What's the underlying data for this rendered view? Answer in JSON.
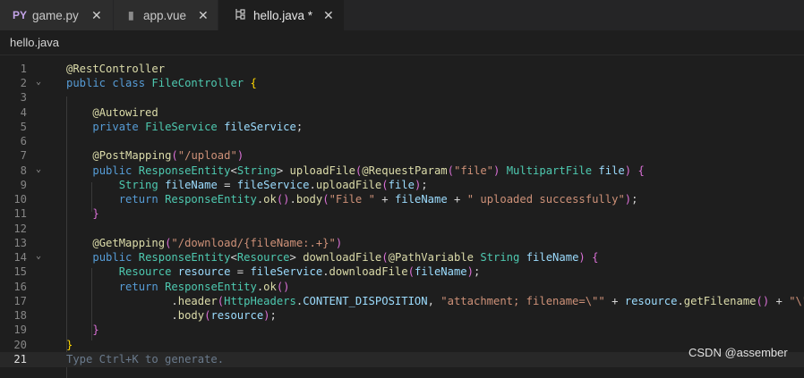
{
  "tabs": [
    {
      "icon": "PY",
      "icon_name": "python-file-icon",
      "label": "game.py",
      "active": false,
      "icon_color": "#c3a4e8"
    },
    {
      "icon": "▮",
      "icon_name": "file-icon",
      "label": "app.vue",
      "active": false,
      "icon_color": "#8a8a8a"
    },
    {
      "icon": "⊱",
      "icon_name": "java-file-icon",
      "label": "hello.java *",
      "active": true,
      "icon_color": "#c8c8c8"
    }
  ],
  "breadcrumb": "hello.java",
  "current_line": 21,
  "lines": [
    {
      "n": "1",
      "fold": false,
      "tokens": [
        {
          "t": "@RestController",
          "c": "ann"
        }
      ]
    },
    {
      "n": "2",
      "fold": true,
      "tokens": [
        {
          "t": "public class ",
          "c": "kw"
        },
        {
          "t": "FileController",
          "c": "cls"
        },
        {
          "t": " ",
          "c": "default"
        },
        {
          "t": "{",
          "c": "brace"
        }
      ]
    },
    {
      "n": "3",
      "fold": false,
      "tokens": []
    },
    {
      "n": "4",
      "fold": false,
      "tokens": [
        {
          "t": "    ",
          "c": "default"
        },
        {
          "t": "@Autowired",
          "c": "ann"
        }
      ]
    },
    {
      "n": "5",
      "fold": false,
      "tokens": [
        {
          "t": "    ",
          "c": "default"
        },
        {
          "t": "private ",
          "c": "kw"
        },
        {
          "t": "FileService ",
          "c": "type"
        },
        {
          "t": "fileService",
          "c": "var"
        },
        {
          "t": ";",
          "c": "punct"
        }
      ]
    },
    {
      "n": "6",
      "fold": false,
      "tokens": []
    },
    {
      "n": "7",
      "fold": false,
      "tokens": [
        {
          "t": "    ",
          "c": "default"
        },
        {
          "t": "@PostMapping",
          "c": "ann"
        },
        {
          "t": "(",
          "c": "brace2"
        },
        {
          "t": "\"/upload\"",
          "c": "str"
        },
        {
          "t": ")",
          "c": "brace2"
        }
      ]
    },
    {
      "n": "8",
      "fold": true,
      "tokens": [
        {
          "t": "    ",
          "c": "default"
        },
        {
          "t": "public ",
          "c": "kw"
        },
        {
          "t": "ResponseEntity",
          "c": "type"
        },
        {
          "t": "<",
          "c": "punct"
        },
        {
          "t": "String",
          "c": "type"
        },
        {
          "t": "> ",
          "c": "punct"
        },
        {
          "t": "uploadFile",
          "c": "fn"
        },
        {
          "t": "(",
          "c": "brace2"
        },
        {
          "t": "@RequestParam",
          "c": "ann"
        },
        {
          "t": "(",
          "c": "brace2"
        },
        {
          "t": "\"file\"",
          "c": "str"
        },
        {
          "t": ")",
          "c": "brace2"
        },
        {
          "t": " MultipartFile ",
          "c": "type"
        },
        {
          "t": "file",
          "c": "var"
        },
        {
          "t": ")",
          "c": "brace2"
        },
        {
          "t": " ",
          "c": "default"
        },
        {
          "t": "{",
          "c": "brace2"
        }
      ]
    },
    {
      "n": "9",
      "fold": false,
      "tokens": [
        {
          "t": "        ",
          "c": "default"
        },
        {
          "t": "String ",
          "c": "type"
        },
        {
          "t": "fileName",
          "c": "var"
        },
        {
          "t": " = ",
          "c": "punct"
        },
        {
          "t": "fileService",
          "c": "var"
        },
        {
          "t": ".",
          "c": "punct"
        },
        {
          "t": "uploadFile",
          "c": "fn"
        },
        {
          "t": "(",
          "c": "brace2"
        },
        {
          "t": "file",
          "c": "var"
        },
        {
          "t": ")",
          "c": "brace2"
        },
        {
          "t": ";",
          "c": "punct"
        }
      ]
    },
    {
      "n": "10",
      "fold": false,
      "tokens": [
        {
          "t": "        ",
          "c": "default"
        },
        {
          "t": "return ",
          "c": "kw"
        },
        {
          "t": "ResponseEntity",
          "c": "type"
        },
        {
          "t": ".",
          "c": "punct"
        },
        {
          "t": "ok",
          "c": "fn"
        },
        {
          "t": "()",
          "c": "brace2"
        },
        {
          "t": ".",
          "c": "punct"
        },
        {
          "t": "body",
          "c": "fn"
        },
        {
          "t": "(",
          "c": "brace2"
        },
        {
          "t": "\"File \"",
          "c": "str"
        },
        {
          "t": " + ",
          "c": "punct"
        },
        {
          "t": "fileName",
          "c": "var"
        },
        {
          "t": " + ",
          "c": "punct"
        },
        {
          "t": "\" uploaded successfully\"",
          "c": "str"
        },
        {
          "t": ")",
          "c": "brace2"
        },
        {
          "t": ";",
          "c": "punct"
        }
      ]
    },
    {
      "n": "11",
      "fold": false,
      "tokens": [
        {
          "t": "    ",
          "c": "default"
        },
        {
          "t": "}",
          "c": "brace2"
        }
      ]
    },
    {
      "n": "12",
      "fold": false,
      "tokens": []
    },
    {
      "n": "13",
      "fold": false,
      "tokens": [
        {
          "t": "    ",
          "c": "default"
        },
        {
          "t": "@GetMapping",
          "c": "ann"
        },
        {
          "t": "(",
          "c": "brace2"
        },
        {
          "t": "\"/download/{fileName:.+}\"",
          "c": "str"
        },
        {
          "t": ")",
          "c": "brace2"
        }
      ]
    },
    {
      "n": "14",
      "fold": true,
      "tokens": [
        {
          "t": "    ",
          "c": "default"
        },
        {
          "t": "public ",
          "c": "kw"
        },
        {
          "t": "ResponseEntity",
          "c": "type"
        },
        {
          "t": "<",
          "c": "punct"
        },
        {
          "t": "Resource",
          "c": "type"
        },
        {
          "t": "> ",
          "c": "punct"
        },
        {
          "t": "downloadFile",
          "c": "fn"
        },
        {
          "t": "(",
          "c": "brace2"
        },
        {
          "t": "@PathVariable",
          "c": "ann"
        },
        {
          "t": " String ",
          "c": "type"
        },
        {
          "t": "fileName",
          "c": "var"
        },
        {
          "t": ")",
          "c": "brace2"
        },
        {
          "t": " ",
          "c": "default"
        },
        {
          "t": "{",
          "c": "brace2"
        }
      ]
    },
    {
      "n": "15",
      "fold": false,
      "tokens": [
        {
          "t": "        ",
          "c": "default"
        },
        {
          "t": "Resource ",
          "c": "type"
        },
        {
          "t": "resource",
          "c": "var"
        },
        {
          "t": " = ",
          "c": "punct"
        },
        {
          "t": "fileService",
          "c": "var"
        },
        {
          "t": ".",
          "c": "punct"
        },
        {
          "t": "downloadFile",
          "c": "fn"
        },
        {
          "t": "(",
          "c": "brace2"
        },
        {
          "t": "fileName",
          "c": "var"
        },
        {
          "t": ")",
          "c": "brace2"
        },
        {
          "t": ";",
          "c": "punct"
        }
      ]
    },
    {
      "n": "16",
      "fold": false,
      "tokens": [
        {
          "t": "        ",
          "c": "default"
        },
        {
          "t": "return ",
          "c": "kw"
        },
        {
          "t": "ResponseEntity",
          "c": "type"
        },
        {
          "t": ".",
          "c": "punct"
        },
        {
          "t": "ok",
          "c": "fn"
        },
        {
          "t": "()",
          "c": "brace2"
        }
      ]
    },
    {
      "n": "17",
      "fold": false,
      "tokens": [
        {
          "t": "                ",
          "c": "default"
        },
        {
          "t": ".",
          "c": "punct"
        },
        {
          "t": "header",
          "c": "fn"
        },
        {
          "t": "(",
          "c": "brace2"
        },
        {
          "t": "HttpHeaders",
          "c": "type"
        },
        {
          "t": ".",
          "c": "punct"
        },
        {
          "t": "CONTENT_DISPOSITION",
          "c": "var"
        },
        {
          "t": ", ",
          "c": "punct"
        },
        {
          "t": "\"attachment; filename=\\\"\"",
          "c": "str"
        },
        {
          "t": " + ",
          "c": "punct"
        },
        {
          "t": "resource",
          "c": "var"
        },
        {
          "t": ".",
          "c": "punct"
        },
        {
          "t": "getFilename",
          "c": "fn"
        },
        {
          "t": "()",
          "c": "brace2"
        },
        {
          "t": " + ",
          "c": "punct"
        },
        {
          "t": "\"\\\"\"",
          "c": "str"
        },
        {
          "t": ")",
          "c": "brace2"
        }
      ]
    },
    {
      "n": "18",
      "fold": false,
      "tokens": [
        {
          "t": "                ",
          "c": "default"
        },
        {
          "t": ".",
          "c": "punct"
        },
        {
          "t": "body",
          "c": "fn"
        },
        {
          "t": "(",
          "c": "brace2"
        },
        {
          "t": "resource",
          "c": "var"
        },
        {
          "t": ")",
          "c": "brace2"
        },
        {
          "t": ";",
          "c": "punct"
        }
      ]
    },
    {
      "n": "19",
      "fold": false,
      "tokens": [
        {
          "t": "    ",
          "c": "default"
        },
        {
          "t": "}",
          "c": "brace2"
        }
      ]
    },
    {
      "n": "20",
      "fold": false,
      "tokens": [
        {
          "t": "}",
          "c": "brace"
        }
      ]
    },
    {
      "n": "21",
      "fold": false,
      "tokens": [
        {
          "t": "Type Ctrl+K to generate.",
          "c": "hint"
        }
      ]
    }
  ],
  "watermark": "CSDN @assember"
}
